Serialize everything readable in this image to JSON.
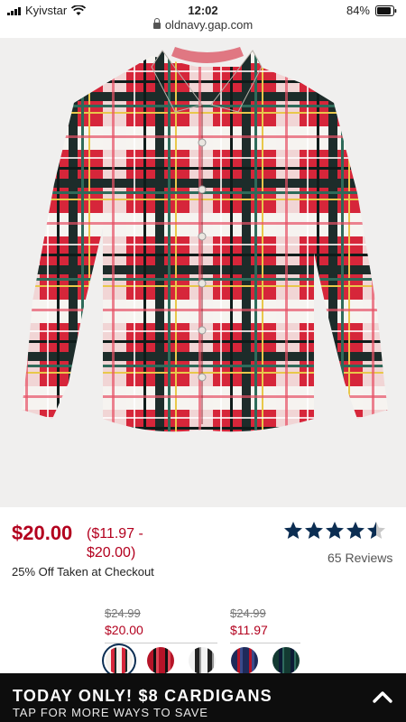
{
  "status_bar": {
    "carrier": "Kyivstar",
    "time": "12:02",
    "battery": "84%"
  },
  "browser": {
    "url": "oldnavy.gap.com"
  },
  "product": {
    "price": "$20.00",
    "price_range": "($11.97 - $20.00)",
    "discount_text": "25% Off Taken at Checkout",
    "rating": 4.5,
    "reviews": "65 Reviews",
    "image_carousel_progress": 0.33
  },
  "variants": [
    {
      "was": "$24.99",
      "now": "$20.00"
    },
    {
      "was": "$24.99",
      "now": "$11.97"
    }
  ],
  "swatches": [
    {
      "name": "white red plaid",
      "selected": true
    },
    {
      "name": "red black plaid",
      "selected": false
    },
    {
      "name": "black white plaid",
      "selected": false
    },
    {
      "name": "navy red plaid",
      "selected": false
    },
    {
      "name": "green navy plaid",
      "selected": false
    }
  ],
  "promo": {
    "title": "TODAY ONLY! $8 CARDIGANS",
    "subtitle": "TAP FOR MORE WAYS TO SAVE"
  },
  "colors": {
    "price_red": "#b3001e",
    "star_navy": "#0b2d52",
    "promo_bg": "#0d0d0d"
  }
}
